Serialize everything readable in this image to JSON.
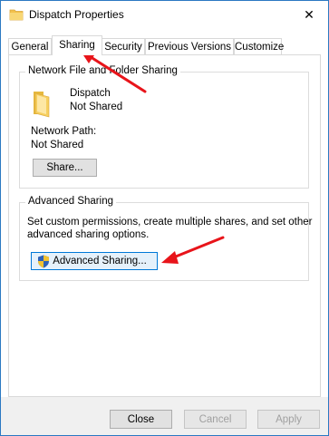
{
  "window": {
    "title": "Dispatch Properties",
    "close_glyph": "✕"
  },
  "tabs": [
    {
      "label": "General"
    },
    {
      "label": "Sharing"
    },
    {
      "label": "Security"
    },
    {
      "label": "Previous Versions"
    },
    {
      "label": "Customize"
    }
  ],
  "network_sharing": {
    "legend": "Network File and Folder Sharing",
    "folder_name": "Dispatch",
    "folder_status": "Not Shared",
    "path_label": "Network Path:",
    "path_value": "Not Shared",
    "share_button": "Share..."
  },
  "advanced_sharing": {
    "legend": "Advanced Sharing",
    "description_line1": "Set custom permissions, create multiple shares, and set other",
    "description_line2": "advanced sharing options.",
    "button": "Advanced Sharing..."
  },
  "buttons": {
    "close": "Close",
    "cancel": "Cancel",
    "apply": "Apply"
  },
  "colors": {
    "arrow": "#e8141a",
    "accent": "#0078d7",
    "folder": "#f3c14b"
  }
}
